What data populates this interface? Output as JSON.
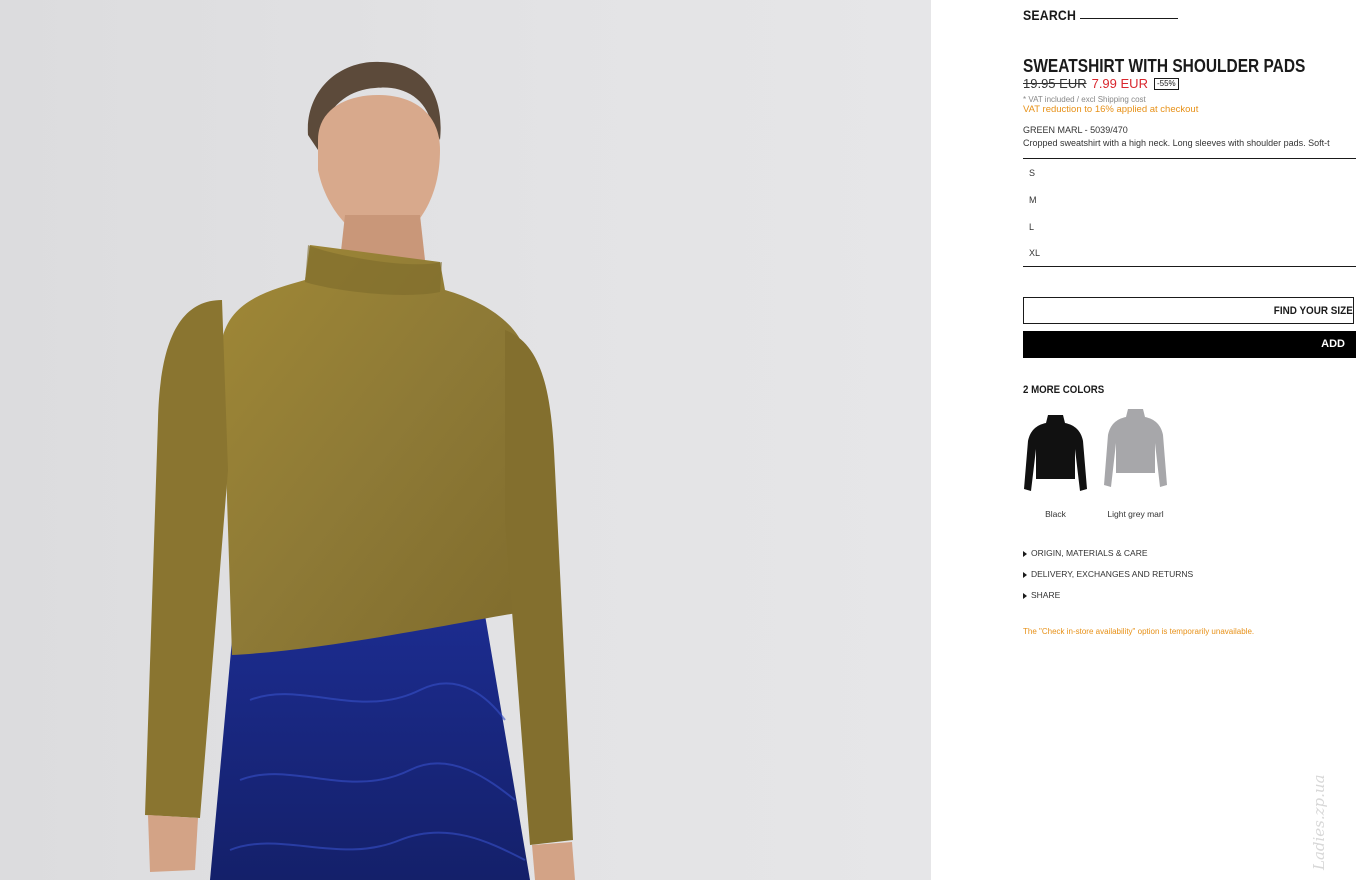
{
  "search": {
    "label": "SEARCH"
  },
  "product": {
    "title": "SWEATSHIRT WITH SHOULDER PADS",
    "old_price": "19.95 EUR",
    "new_price": "7.99 EUR",
    "discount": "-55%",
    "vat_note": "* VAT included / excl Shipping cost",
    "vat_reduction": "VAT reduction to 16% applied at checkout",
    "color_ref": "GREEN MARL - 5039/470",
    "description": "Cropped sweatshirt with a high neck. Long sleeves with shoulder pads. Soft-t"
  },
  "sizes": [
    "S",
    "M",
    "L",
    "XL"
  ],
  "buttons": {
    "find_size": "FIND YOUR SIZE",
    "add": "ADD"
  },
  "colors": {
    "heading": "2 MORE COLORS",
    "items": [
      {
        "label": "Black",
        "swatch": "#111111"
      },
      {
        "label": "Light grey marl",
        "swatch": "#a7a7aa"
      }
    ]
  },
  "accordion": [
    "ORIGIN, MATERIALS & CARE",
    "DELIVERY, EXCHANGES AND RETURNS",
    "SHARE"
  ],
  "notice": "The \"Check in-store availability\" option is temporarily unavailable.",
  "watermark": "Ladies.zp.ua",
  "theme": {
    "sale_red": "#d9272e",
    "notice_orange": "#e79118",
    "sweater": "#8f7a35",
    "skirt": "#1b2a86"
  }
}
